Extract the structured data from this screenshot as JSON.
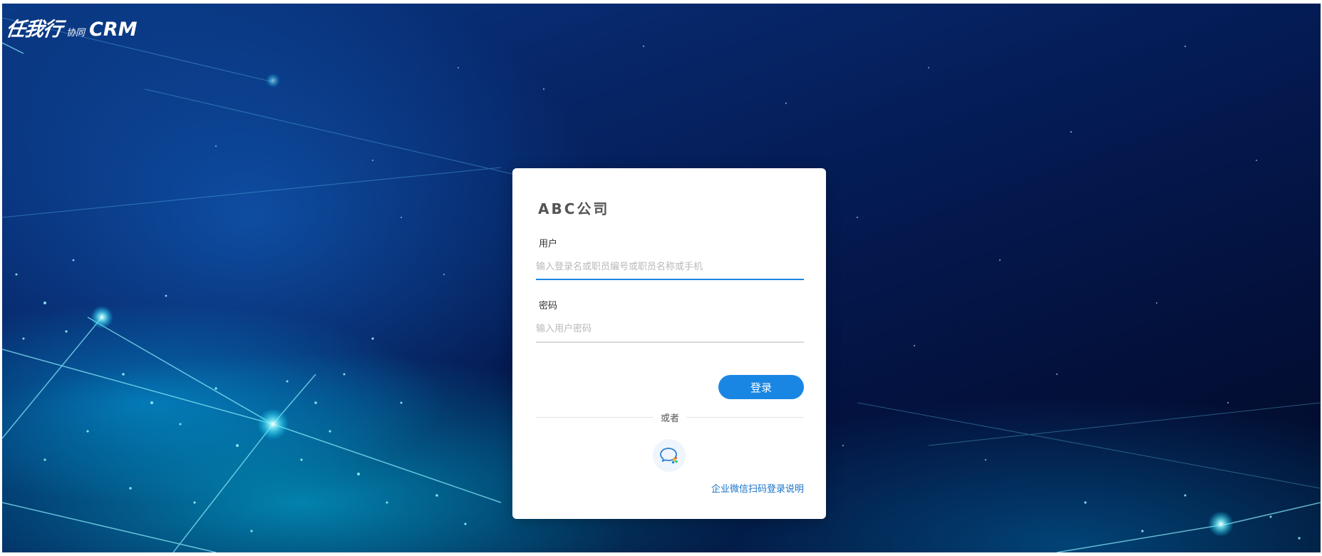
{
  "logo": {
    "main": "任我行",
    "sub": "协同",
    "crm": "CRM"
  },
  "login": {
    "company": "ABC公司",
    "username": {
      "label": "用户",
      "value": "",
      "placeholder": "输入登录名或职员编号或职员名称或手机"
    },
    "password": {
      "label": "密码",
      "value": "",
      "placeholder": "输入用户密码"
    },
    "submit_label": "登录",
    "divider_text": "或者",
    "wechat_icon": "wechat-work-icon",
    "help_link": "企业微信扫码登录说明"
  },
  "colors": {
    "primary": "#1a86e4",
    "link": "#1773c8",
    "active_underline": "#1a86e4",
    "inactive_underline": "#d9d9d9"
  }
}
